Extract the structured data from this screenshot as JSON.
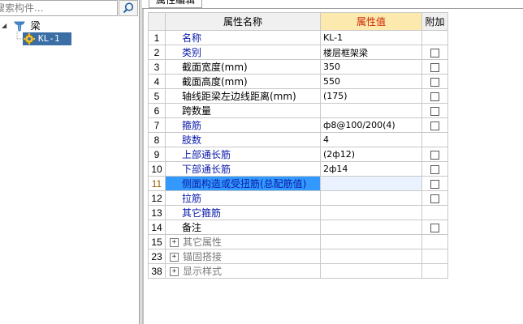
{
  "search": {
    "placeholder": "搜索构件..."
  },
  "tree": {
    "root": {
      "label": "梁",
      "expander": "◢",
      "icon": "beam-category-icon"
    },
    "child": {
      "label": "KL-1",
      "icon": "gear-icon"
    }
  },
  "panel": {
    "title": "属性编辑"
  },
  "grid": {
    "headers": {
      "num": "",
      "name": "属性名称",
      "value": "属性值",
      "attach": "附加"
    },
    "rows": [
      {
        "num": "1",
        "name": "名称",
        "value": "KL-1",
        "style": "blue",
        "checkbox": false
      },
      {
        "num": "2",
        "name": "类别",
        "value": "楼层框架梁",
        "style": "blue",
        "checkbox": true
      },
      {
        "num": "3",
        "name": "截面宽度(mm)",
        "value": "350",
        "style": "black",
        "checkbox": true
      },
      {
        "num": "4",
        "name": "截面高度(mm)",
        "value": "550",
        "style": "black",
        "checkbox": true
      },
      {
        "num": "5",
        "name": "轴线距梁左边线距离(mm)",
        "value": "(175)",
        "style": "black",
        "checkbox": true
      },
      {
        "num": "6",
        "name": "跨数量",
        "value": "",
        "style": "black",
        "checkbox": true
      },
      {
        "num": "7",
        "name": "箍筋",
        "value": "ф8@100/200(4)",
        "style": "blue",
        "checkbox": true
      },
      {
        "num": "8",
        "name": "肢数",
        "value": "4",
        "style": "blue",
        "checkbox": false
      },
      {
        "num": "9",
        "name": "上部通长筋",
        "value": "(2ф12)",
        "style": "blue",
        "checkbox": true
      },
      {
        "num": "10",
        "name": "下部通长筋",
        "value": "2ф14",
        "style": "blue",
        "checkbox": true
      },
      {
        "num": "11",
        "name": "侧面构造或受扭筋(总配筋值)",
        "value": "",
        "style": "blue",
        "checkbox": true,
        "selected": true
      },
      {
        "num": "12",
        "name": "拉筋",
        "value": "",
        "style": "blue",
        "checkbox": true
      },
      {
        "num": "13",
        "name": "其它箍筋",
        "value": "",
        "style": "blue",
        "checkbox": false
      },
      {
        "num": "14",
        "name": "备注",
        "value": "",
        "style": "black",
        "checkbox": true
      },
      {
        "num": "15",
        "name": "其它属性",
        "value": "",
        "style": "gray",
        "group": true,
        "expander": "+"
      },
      {
        "num": "23",
        "name": "锚固搭接",
        "value": "",
        "style": "gray",
        "group": true,
        "expander": "+"
      },
      {
        "num": "38",
        "name": "显示样式",
        "value": "",
        "style": "gray",
        "group": true,
        "expander": "+"
      }
    ]
  },
  "colors": {
    "value_header_bg": "#fbe9ae",
    "value_header_text": "#cc2200",
    "selection": "#3399ff",
    "blue_text": "#0a1aa8"
  }
}
